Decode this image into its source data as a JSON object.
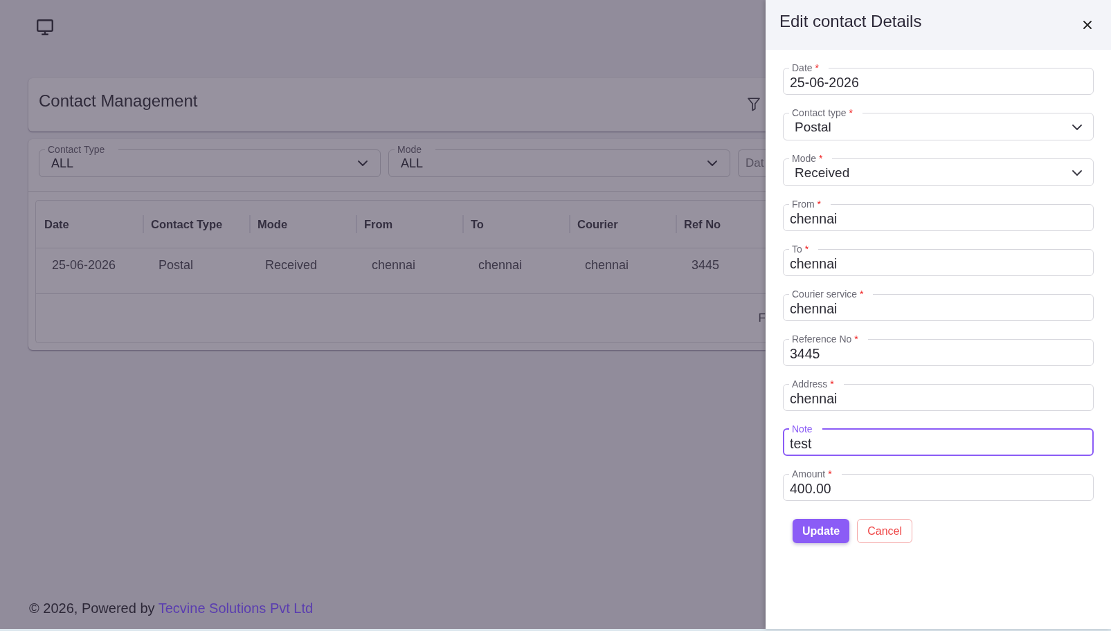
{
  "header": {
    "title": "Contact Management"
  },
  "filters": [
    {
      "kind": "select",
      "label": "Contact Type",
      "value": "ALL"
    },
    {
      "kind": "select",
      "label": "Mode",
      "value": "ALL"
    },
    {
      "kind": "input",
      "placeholder": "Dat"
    }
  ],
  "table": {
    "columns": [
      "Date",
      "Contact Type",
      "Mode",
      "From",
      "To",
      "Courier",
      "Ref No"
    ],
    "rows": [
      [
        "25-06-2026",
        "Postal",
        "Received",
        "chennai",
        "chennai",
        "chennai",
        "3445"
      ]
    ],
    "pagination_text": "F"
  },
  "footer": {
    "text": "© 2026, Powered by",
    "link": "Tecvine Solutions Pvt Ltd"
  },
  "drawer": {
    "title": "Edit contact Details",
    "fields": [
      {
        "kind": "input",
        "label": "Date",
        "required_mark": "*",
        "value": "25-06-2026",
        "focused": false
      },
      {
        "kind": "select",
        "label": "Contact type",
        "required_mark": "*",
        "value": "Postal",
        "focused": false
      },
      {
        "kind": "select",
        "label": "Mode",
        "required_mark": "*",
        "value": "Received",
        "focused": false
      },
      {
        "kind": "input",
        "label": "From",
        "required_mark": "*",
        "value": "chennai",
        "focused": false
      },
      {
        "kind": "input",
        "label": "To",
        "required_mark": "*",
        "value": "chennai",
        "focused": false
      },
      {
        "kind": "input",
        "label": "Courier service",
        "required_mark": "*",
        "value": "chennai",
        "focused": false
      },
      {
        "kind": "input",
        "label": "Reference No",
        "required_mark": "*",
        "value": "3445",
        "focused": false
      },
      {
        "kind": "input",
        "label": "Address",
        "required_mark": "*",
        "value": "chennai",
        "focused": false
      },
      {
        "kind": "input",
        "label": "Note",
        "value": "test",
        "focused": true
      },
      {
        "kind": "input",
        "label": "Amount",
        "required_mark": "*",
        "value": "400.00",
        "focused": false
      }
    ],
    "buttons": [
      {
        "kind": "primary",
        "label": "Update"
      },
      {
        "kind": "secondary",
        "label": "Cancel"
      }
    ]
  }
}
